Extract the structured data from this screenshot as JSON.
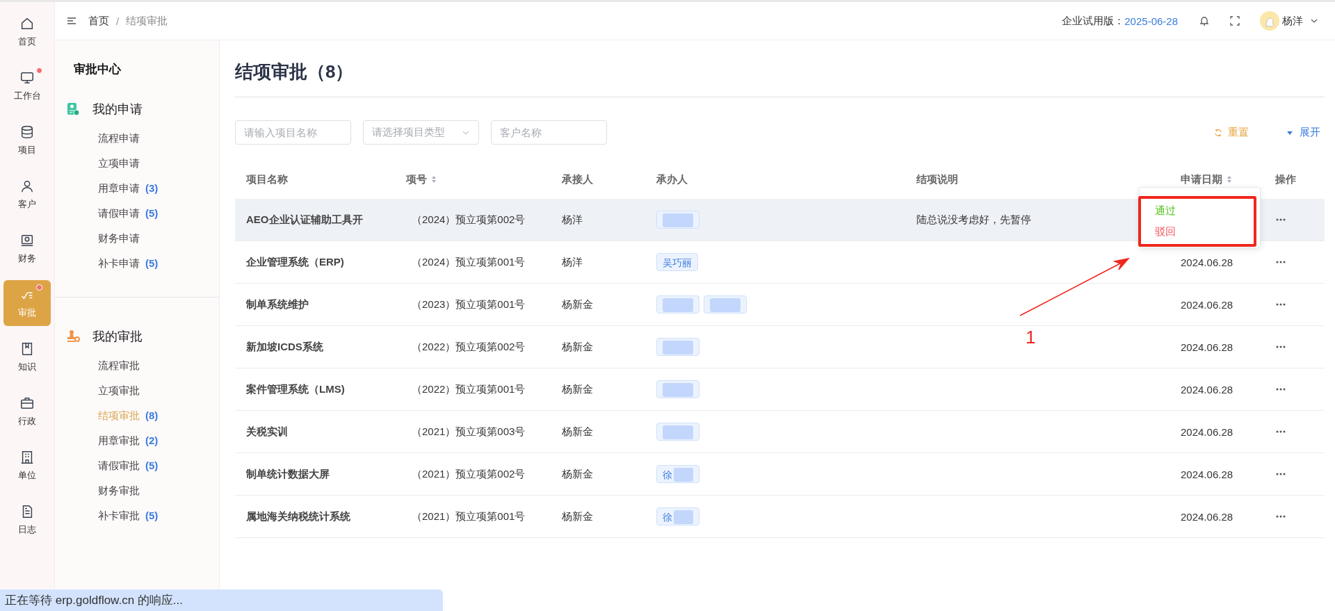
{
  "rail": [
    {
      "label": "首页",
      "selected": false,
      "dot": false
    },
    {
      "label": "工作台",
      "selected": false,
      "dot": true
    },
    {
      "label": "项目",
      "selected": false,
      "dot": false
    },
    {
      "label": "客户",
      "selected": false,
      "dot": false
    },
    {
      "label": "财务",
      "selected": false,
      "dot": false
    },
    {
      "label": "审批",
      "selected": true,
      "dot": true
    },
    {
      "label": "知识",
      "selected": false,
      "dot": false
    },
    {
      "label": "行政",
      "selected": false,
      "dot": false
    },
    {
      "label": "单位",
      "selected": false,
      "dot": false
    },
    {
      "label": "日志",
      "selected": false,
      "dot": false
    }
  ],
  "breadcrumb": {
    "items": [
      "首页",
      "结项审批"
    ],
    "separator": "/"
  },
  "header": {
    "trial_label": "企业试用版：",
    "trial_date": "2025-06-28",
    "user": "杨洋"
  },
  "sidebar": {
    "title": "审批中心",
    "sections": [
      {
        "title": "我的申请",
        "items": [
          {
            "label": "流程申请",
            "selected": false
          },
          {
            "label": "立项申请",
            "selected": false
          },
          {
            "label": "用章申请",
            "count": "(3)",
            "selected": false
          },
          {
            "label": "请假申请",
            "count": "(5)",
            "selected": false
          },
          {
            "label": "财务申请",
            "selected": false
          },
          {
            "label": "补卡申请",
            "count": "(5)",
            "selected": false
          }
        ]
      },
      {
        "title": "我的审批",
        "items": [
          {
            "label": "流程审批",
            "selected": false
          },
          {
            "label": "立项审批",
            "selected": false
          },
          {
            "label": "结项审批",
            "count": "(8)",
            "selected": true
          },
          {
            "label": "用章审批",
            "count": "(2)",
            "selected": false
          },
          {
            "label": "请假审批",
            "count": "(5)",
            "selected": false
          },
          {
            "label": "财务审批",
            "selected": false
          },
          {
            "label": "补卡审批",
            "count": "(5)",
            "selected": false
          }
        ]
      }
    ]
  },
  "page_title": "结项审批（8）",
  "filters": [
    {
      "kind": "input",
      "placeholder": "请输入项目名称"
    },
    {
      "kind": "select",
      "placeholder": "请选择项目类型"
    },
    {
      "kind": "input",
      "placeholder": "客户名称"
    }
  ],
  "actions": {
    "reset": "重置",
    "expand": "展开"
  },
  "table": {
    "columns": [
      {
        "label": "项目名称",
        "sortable": false
      },
      {
        "label": "项号",
        "sortable": true
      },
      {
        "label": "承接人",
        "sortable": false
      },
      {
        "label": "承办人",
        "sortable": false
      },
      {
        "label": "结项说明",
        "sortable": false
      },
      {
        "label": "申请日期",
        "sortable": true
      },
      {
        "label": "操作",
        "sortable": false
      }
    ],
    "rows": [
      {
        "name": "AEO企业认证辅助工具开",
        "number": "（2024）预立项第002号",
        "receiver": "杨洋",
        "handlers": [
          {
            "kind": "redacted"
          }
        ],
        "note": "陆总说没考虑好，先暂停",
        "selected": true
      },
      {
        "name": "企业管理系统（ERP)",
        "number": "（2024）预立项第001号",
        "receiver": "杨洋",
        "handlers": [
          {
            "kind": "name",
            "text": "吴巧丽"
          }
        ],
        "date": "2024.06.28",
        "selected": false
      },
      {
        "name": "制单系统维护",
        "number": "（2023）预立项第001号",
        "receiver": "杨新金",
        "handlers": [
          {
            "kind": "redacted"
          },
          {
            "kind": "redacted"
          }
        ],
        "date": "2024.06.28",
        "selected": false
      },
      {
        "name": "新加坡ICDS系统",
        "number": "（2022）预立项第002号",
        "receiver": "杨新金",
        "handlers": [
          {
            "kind": "redacted"
          }
        ],
        "date": "2024.06.28",
        "selected": false
      },
      {
        "name": "案件管理系统（LMS)",
        "number": "（2022）预立项第001号",
        "receiver": "杨新金",
        "handlers": [
          {
            "kind": "redacted"
          }
        ],
        "date": "2024.06.28",
        "selected": false
      },
      {
        "name": "关税实训",
        "number": "（2021）预立项第003号",
        "receiver": "杨新金",
        "handlers": [
          {
            "kind": "redacted"
          }
        ],
        "date": "2024.06.28",
        "selected": false
      },
      {
        "name": "制单统计数据大屏",
        "number": "（2021）预立项第002号",
        "receiver": "杨新金",
        "handlers": [
          {
            "kind": "partial",
            "text": "徐"
          }
        ],
        "date": "2024.06.28",
        "selected": false
      },
      {
        "name": "属地海关纳税统计系统",
        "number": "（2021）预立项第001号",
        "receiver": "杨新金",
        "handlers": [
          {
            "kind": "partial",
            "text": "徐"
          }
        ],
        "date": "2024.06.28",
        "selected": false
      }
    ]
  },
  "popup": {
    "items": [
      {
        "kind": "approve",
        "label": "通过"
      },
      {
        "kind": "reject",
        "label": "驳回"
      }
    ]
  },
  "annotation": {
    "label": "1"
  },
  "status_bar": "正在等待 erp.goldflow.cn 的响应..."
}
